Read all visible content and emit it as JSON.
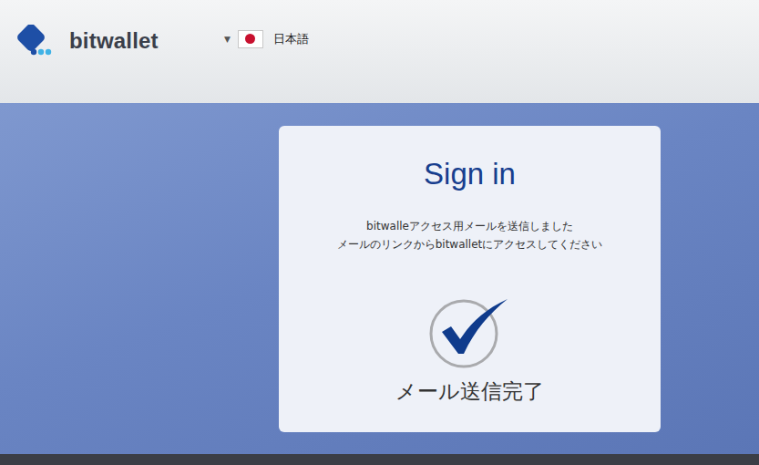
{
  "header": {
    "logo": "bitwallet",
    "language": {
      "caret": "▼",
      "label": "日本語"
    }
  },
  "card": {
    "title": "Sign in",
    "message": [
      "bitwalleアクセス用メールを送信しました",
      "メールのリンクからbitwalletにアクセスしてください"
    ],
    "status": "メール送信完了"
  }
}
